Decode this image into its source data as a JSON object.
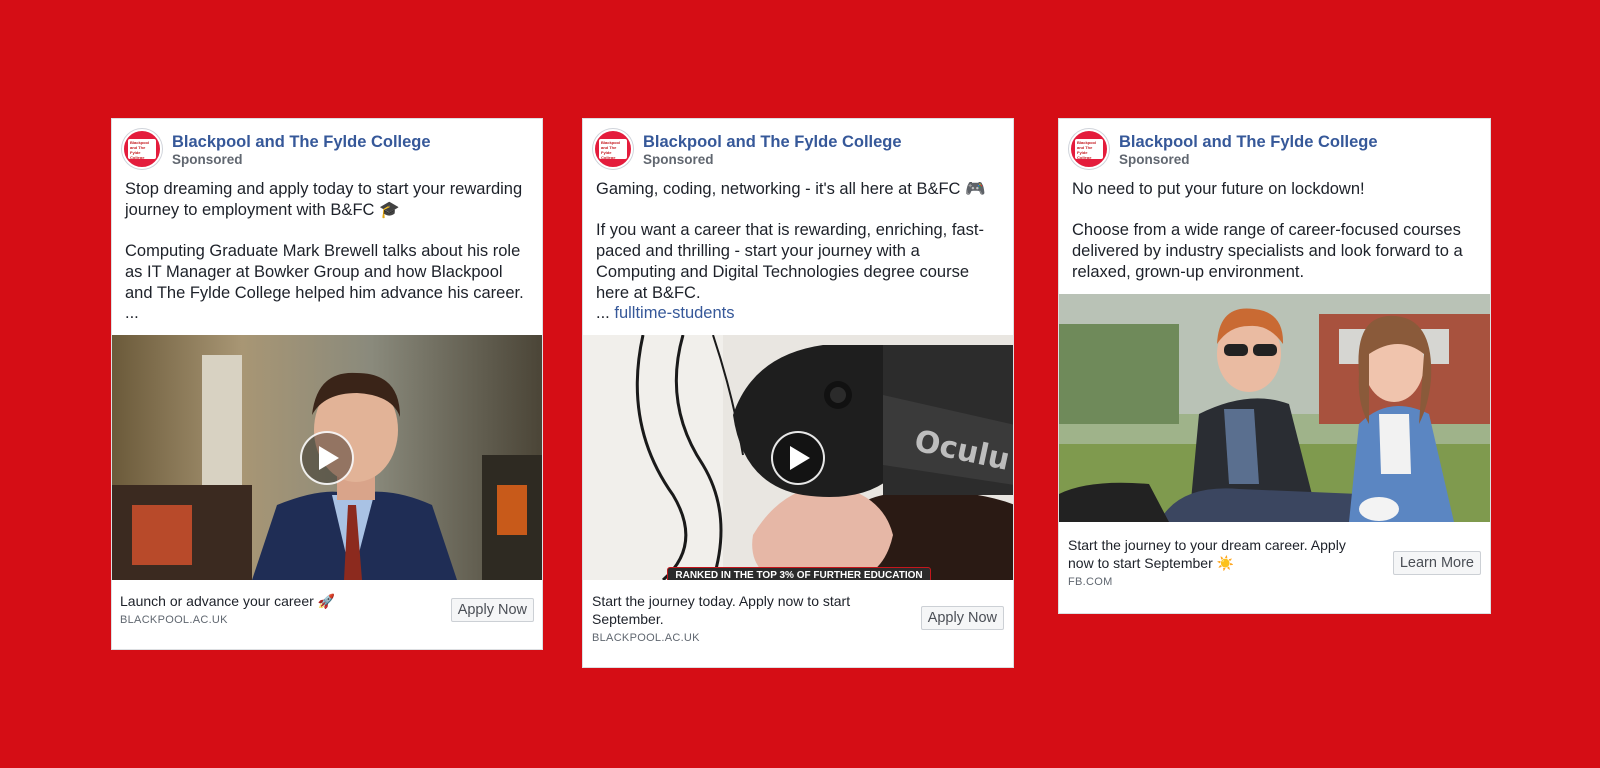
{
  "page": {
    "background_color": "#d50d15"
  },
  "ads": [
    {
      "page_name": "Blackpool and The Fylde College",
      "sponsored": "Sponsored",
      "avatar_logo_text": "Blackpool and The Fylde College",
      "body": [
        "Stop dreaming and apply today to start your rewarding journey to employment with B&FC 🎓",
        "",
        "Computing Graduate Mark Brewell talks about his role as IT Manager at Bowker Group and how Blackpool and The Fylde College helped him advance his career.",
        "..."
      ],
      "media": {
        "type": "video",
        "icon": "play-icon"
      },
      "headline": "Launch or advance your career 🚀",
      "domain": "BLACKPOOL.AC.UK",
      "cta": "Apply Now"
    },
    {
      "page_name": "Blackpool and The Fylde College",
      "sponsored": "Sponsored",
      "avatar_logo_text": "Blackpool and The Fylde College",
      "body": [
        "Gaming, coding, networking - it's all here at B&FC 🎮",
        "",
        "If you want a career that is rewarding, enriching, fast-paced and thrilling - start your journey with a Computing and Digital Technologies degree course here at B&FC."
      ],
      "ellipsis": "...",
      "link_text": "fulltime-students",
      "media": {
        "type": "video",
        "icon": "play-icon",
        "headset_text": "Oculu",
        "banner_text": "RANKED IN THE TOP 3% OF FURTHER EDUCATION"
      },
      "headline": "Start the journey today. Apply now to start September.",
      "domain": "BLACKPOOL.AC.UK",
      "cta": "Apply Now"
    },
    {
      "page_name": "Blackpool and The Fylde College",
      "sponsored": "Sponsored",
      "avatar_logo_text": "Blackpool and The Fylde College",
      "body": [
        "No need to put your future on lockdown!",
        "",
        "Choose from a wide range of career-focused courses delivered by industry specialists and look forward to a relaxed, grown-up environment."
      ],
      "media": {
        "type": "image"
      },
      "headline": "Start the journey to your dream career. Apply now to start September ☀️",
      "domain": "FB.COM",
      "cta": "Learn More"
    }
  ]
}
